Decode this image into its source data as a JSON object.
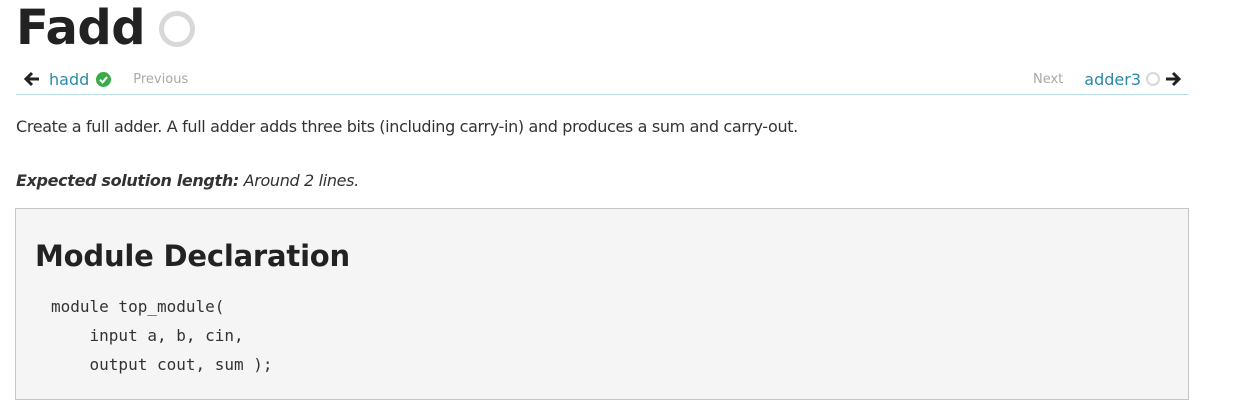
{
  "page": {
    "title": "Fadd"
  },
  "nav": {
    "prev": {
      "label": "hadd",
      "hint": "Previous"
    },
    "next": {
      "label": "adder3",
      "hint": "Next"
    }
  },
  "content": {
    "description": "Create a full adder. A full adder adds three bits (including carry-in) and produces a sum and carry-out.",
    "expected_label": "Expected solution length:",
    "expected_value": "Around 2 lines."
  },
  "module": {
    "heading": "Module Declaration",
    "code_lines": [
      "module top_module(",
      "    input a, b, cin,",
      "    output cout, sum );"
    ]
  },
  "colors": {
    "link": "#2a8aa8",
    "check": "#3aaa4a",
    "status_empty": "#d8d8d8",
    "nav_border": "#b9dde6",
    "box_background": "#f5f5f5"
  },
  "icons": {
    "title_status": "status-circle-empty-icon",
    "prev_arrow": "arrow-left-icon",
    "prev_status": "check-circle-icon",
    "next_status": "status-circle-empty-icon",
    "next_arrow": "arrow-right-icon"
  }
}
